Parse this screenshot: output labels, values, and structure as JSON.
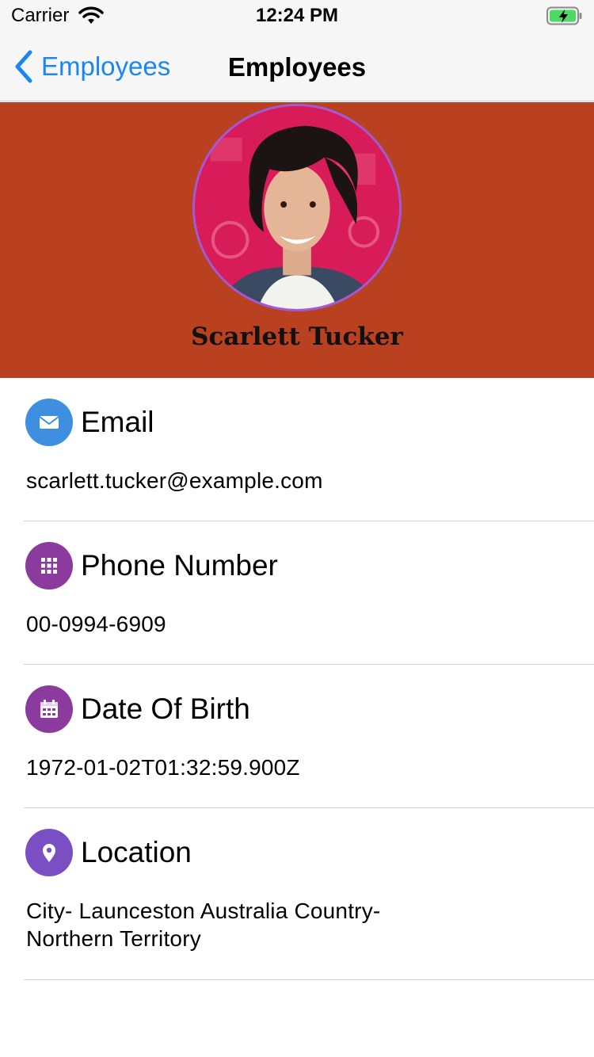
{
  "status_bar": {
    "carrier": "Carrier",
    "time": "12:24 PM",
    "icons": [
      "wifi-icon",
      "battery-charging-icon"
    ]
  },
  "nav": {
    "back_label": "Employees",
    "title": "Employees"
  },
  "profile": {
    "name": "Scarlett Tucker",
    "header_color": "#b9411f",
    "avatar_border_color": "#a259d9"
  },
  "details": [
    {
      "label": "Email",
      "value": "scarlett.tucker@example.com",
      "icon": "email-icon",
      "icon_color": "#3f8fe0"
    },
    {
      "label": "Phone Number",
      "value": "00-0994-6909",
      "icon": "dialpad-icon",
      "icon_color": "#8b3a9e"
    },
    {
      "label": "Date Of Birth",
      "value": "1972-01-02T01:32:59.900Z",
      "icon": "calendar-icon",
      "icon_color": "#8b3a9e"
    },
    {
      "label": "Location",
      "value": "City-  Launceston Australia Country-\nNorthern Territory",
      "icon": "location-pin-icon",
      "icon_color": "#7a4fc4"
    }
  ]
}
